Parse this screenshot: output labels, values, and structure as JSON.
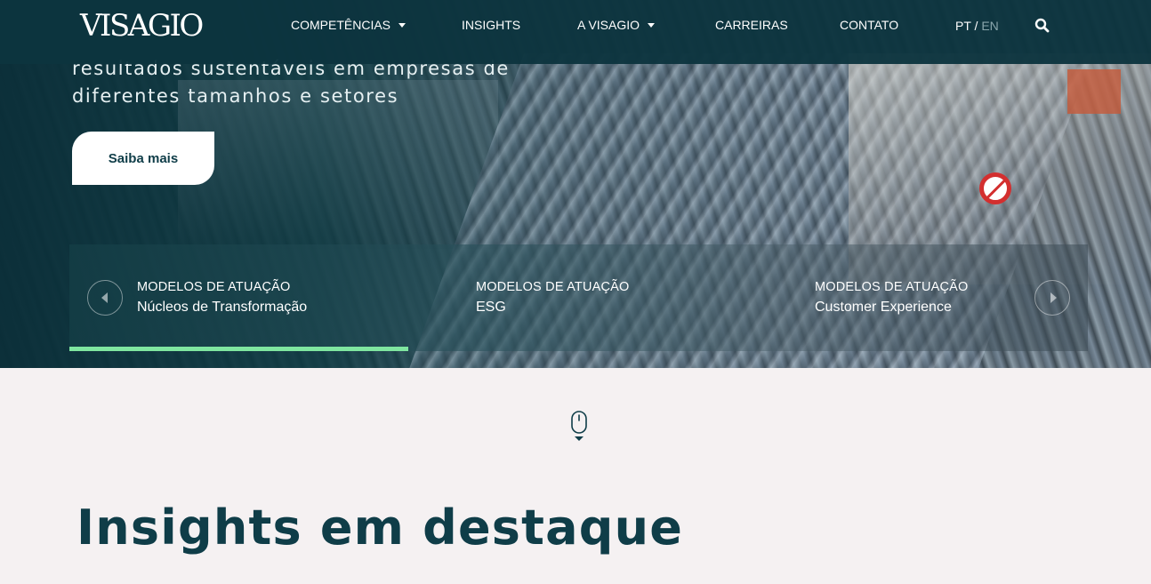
{
  "brand": {
    "logo_text": "VISAGIO"
  },
  "nav": {
    "items": [
      {
        "label": "COMPETÊNCIAS",
        "has_dropdown": true
      },
      {
        "label": "INSIGHTS",
        "has_dropdown": false
      },
      {
        "label": "A VISAGIO",
        "has_dropdown": true
      },
      {
        "label": "CARREIRAS",
        "has_dropdown": false
      },
      {
        "label": "CONTATO",
        "has_dropdown": false
      }
    ],
    "lang": {
      "pt": "PT",
      "sep": "/",
      "en": "EN",
      "active": "PT"
    },
    "search_icon": "search-icon"
  },
  "hero": {
    "text_line1": "resultados sustentáveis em empresas de",
    "text_line2": "diferentes tamanhos e setores",
    "cta_label": "Saiba mais"
  },
  "carousel": {
    "slides": [
      {
        "kicker": "MODELOS DE ATUAÇÃO",
        "title": "Núcleos de Transformação"
      },
      {
        "kicker": "MODELOS DE ATUAÇÃO",
        "title": "ESG"
      },
      {
        "kicker": "MODELOS DE ATUAÇÃO",
        "title": "Customer Experience"
      }
    ],
    "progress_fraction": 0.333,
    "accent_color": "#7fe6a0"
  },
  "section": {
    "title": "Insights em destaque"
  },
  "colors": {
    "primary": "#0f3d48",
    "nav_bg": "#0c343e",
    "page_bg": "#f5f1f2"
  }
}
